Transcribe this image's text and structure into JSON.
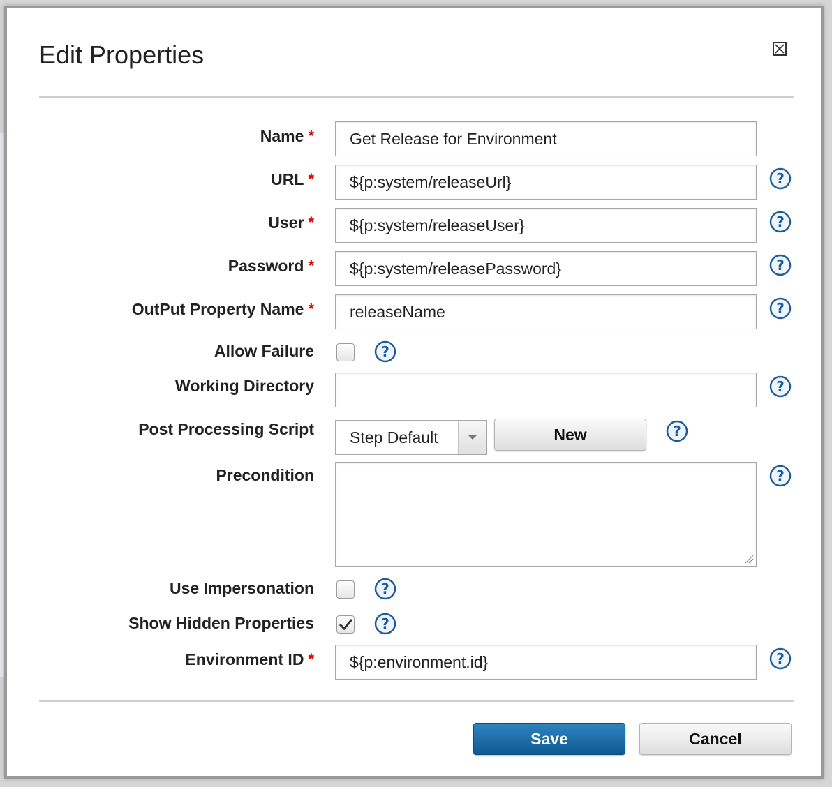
{
  "dialog": {
    "title": "Edit Properties"
  },
  "form": {
    "name": {
      "label": "Name",
      "required": "*",
      "value": "Get Release for Environment"
    },
    "url": {
      "label": "URL",
      "required": "*",
      "value": "${p:system/releaseUrl}"
    },
    "user": {
      "label": "User",
      "required": "*",
      "value": "${p:system/releaseUser}"
    },
    "password": {
      "label": "Password",
      "required": "*",
      "value": "${p:system/releasePassword}"
    },
    "output_property": {
      "label": "OutPut Property Name",
      "required": "*",
      "value": "releaseName"
    },
    "allow_failure": {
      "label": "Allow Failure",
      "checked": false
    },
    "working_directory": {
      "label": "Working Directory",
      "value": ""
    },
    "post_processing": {
      "label": "Post Processing Script",
      "selected": "Step Default",
      "new_label": "New"
    },
    "precondition": {
      "label": "Precondition",
      "value": ""
    },
    "use_impersonation": {
      "label": "Use Impersonation",
      "checked": false
    },
    "show_hidden": {
      "label": "Show Hidden Properties",
      "checked": true
    },
    "environment_id": {
      "label": "Environment ID",
      "required": "*",
      "value": "${p:environment.id}"
    }
  },
  "footer": {
    "save_label": "Save",
    "cancel_label": "Cancel"
  },
  "colors": {
    "primary_button": "#1a6aa6",
    "required_marker": "#e00000",
    "help_icon": "#1d5c99"
  },
  "icons": [
    "close-icon",
    "help-icon",
    "checkmark-icon",
    "dropdown-arrow-icon",
    "resize-grip-icon"
  ]
}
